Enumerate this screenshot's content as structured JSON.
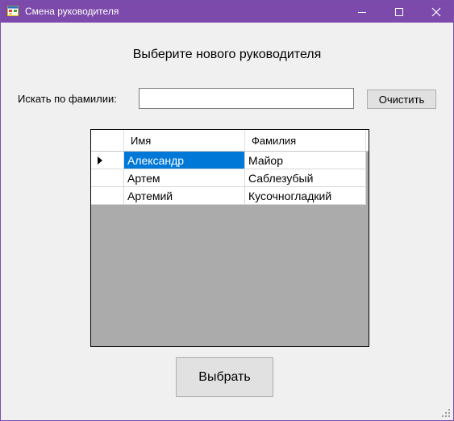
{
  "window": {
    "title": "Смена руководителя",
    "accent_color": "#7b4aaa",
    "controls": [
      "minimize-icon",
      "maximize-icon",
      "close-icon"
    ]
  },
  "heading": "Выберите нового руководителя",
  "search": {
    "label": "Искать по фамилии:",
    "value": "",
    "clear_label": "Очистить"
  },
  "grid": {
    "columns": [
      "Имя",
      "Фамилия"
    ],
    "rows": [
      {
        "first": "Александр",
        "last": "Майор",
        "selected": true
      },
      {
        "first": "Артем",
        "last": "Саблезубый",
        "selected": false
      },
      {
        "first": "Артемий",
        "last": "Кусочногладкий",
        "selected": false
      }
    ],
    "selection_color": "#0078d7"
  },
  "choose_label": "Выбрать"
}
